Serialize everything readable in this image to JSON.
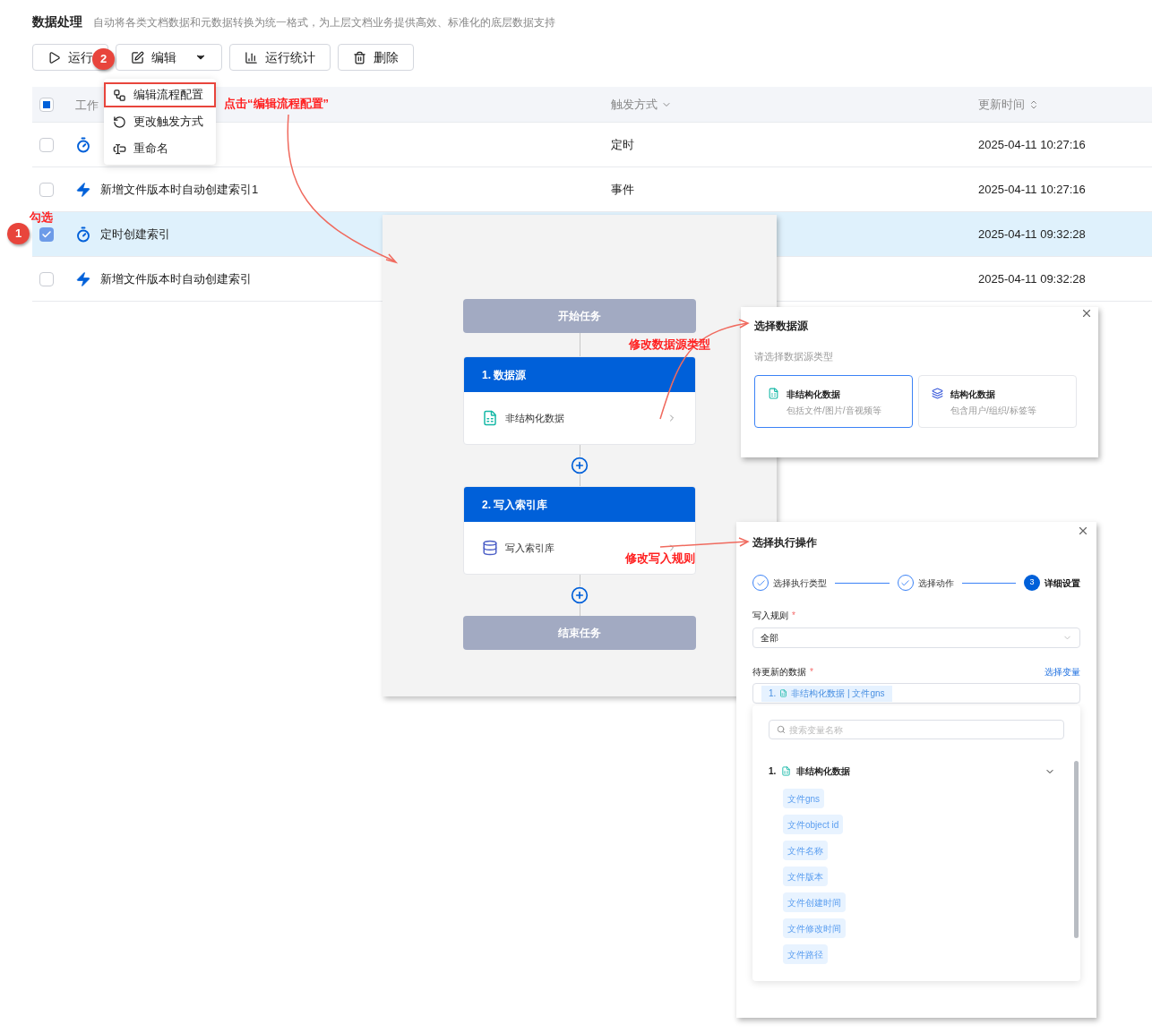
{
  "page": {
    "title": "数据处理",
    "description": "自动将各类文档数据和元数据转换为统一格式，为上层文档业务提供高效、标准化的底层数据支持"
  },
  "toolbar": [
    {
      "label": "运行",
      "dropdown": false
    },
    {
      "label": "编辑",
      "dropdown": true
    },
    {
      "label": "运行统计",
      "dropdown": false
    },
    {
      "label": "删除",
      "dropdown": false
    }
  ],
  "edit_menu": [
    {
      "label": "编辑流程配置",
      "highlighted": true
    },
    {
      "label": "更改触发方式",
      "highlighted": false
    },
    {
      "label": "重命名",
      "highlighted": false
    }
  ],
  "table": {
    "header_checkbox": {
      "partial": true
    },
    "columns": [
      "工作",
      "触发方式",
      "更新时间"
    ],
    "rows": [
      {
        "checked": false,
        "kind": "scheduled",
        "trigger": "定时",
        "updated": "2025-04-11 10:27:16"
      },
      {
        "checked": false,
        "kind": "event",
        "name": "新增文件版本时自动创建索引1",
        "trigger": "事件",
        "updated": "2025-04-11 10:27:16"
      },
      {
        "checked": true,
        "kind": "scheduled",
        "name": "定时创建索引",
        "updated": "2025-04-11 09:32:28"
      },
      {
        "checked": false,
        "kind": "event",
        "name": "新增文件版本时自动创建索引",
        "updated": "2025-04-11 09:32:28"
      }
    ]
  },
  "flow": {
    "nodes": [
      {
        "kind": "terminal",
        "label": "开始任务"
      },
      {
        "kind": "source",
        "title": "1. 数据源",
        "item": "非结构化数据"
      },
      {
        "kind": "write",
        "title": "2. 写入索引库",
        "item": "写入索引库"
      },
      {
        "kind": "terminal",
        "label": "结束任务"
      }
    ]
  },
  "datasource_dialog": {
    "title": "选择数据源",
    "prompt": "请选择数据源类型",
    "options": [
      {
        "title": "非结构化数据",
        "desc": "包括文件/图片/音视频等",
        "selected": true
      },
      {
        "title": "结构化数据",
        "desc": "包含用户/组织/标签等",
        "selected": false
      }
    ]
  },
  "action_dialog": {
    "title": "选择执行操作",
    "steps": [
      {
        "label": "选择执行类型",
        "completed": true,
        "selected": false
      },
      {
        "label": "选择动作",
        "completed": true,
        "selected": false
      },
      {
        "label": "详细设置",
        "number": "3",
        "completed": false,
        "selected": true
      }
    ],
    "write_rule": {
      "label": "写入规则",
      "required_mark": "*",
      "value": "全部"
    },
    "data": {
      "label": "待更新的数据",
      "required_mark": "*",
      "link": "选择变量",
      "tag_index": "1.",
      "tag_text": "非结构化数据 | 文件gns"
    },
    "picker": {
      "placeholder": "搜索变量名称",
      "group": {
        "index": "1.",
        "title": "非结构化数据",
        "expanded": true,
        "fields": [
          "文件gns",
          "文件object id",
          "文件名称",
          "文件版本",
          "文件创建时间",
          "文件修改时间",
          "文件路径"
        ]
      }
    }
  },
  "annotations": {
    "badges": [
      "1",
      "2"
    ],
    "notes": [
      "勾选",
      "点击“编辑流程配置”",
      "修改数据源类型",
      "修改写入规则"
    ]
  }
}
